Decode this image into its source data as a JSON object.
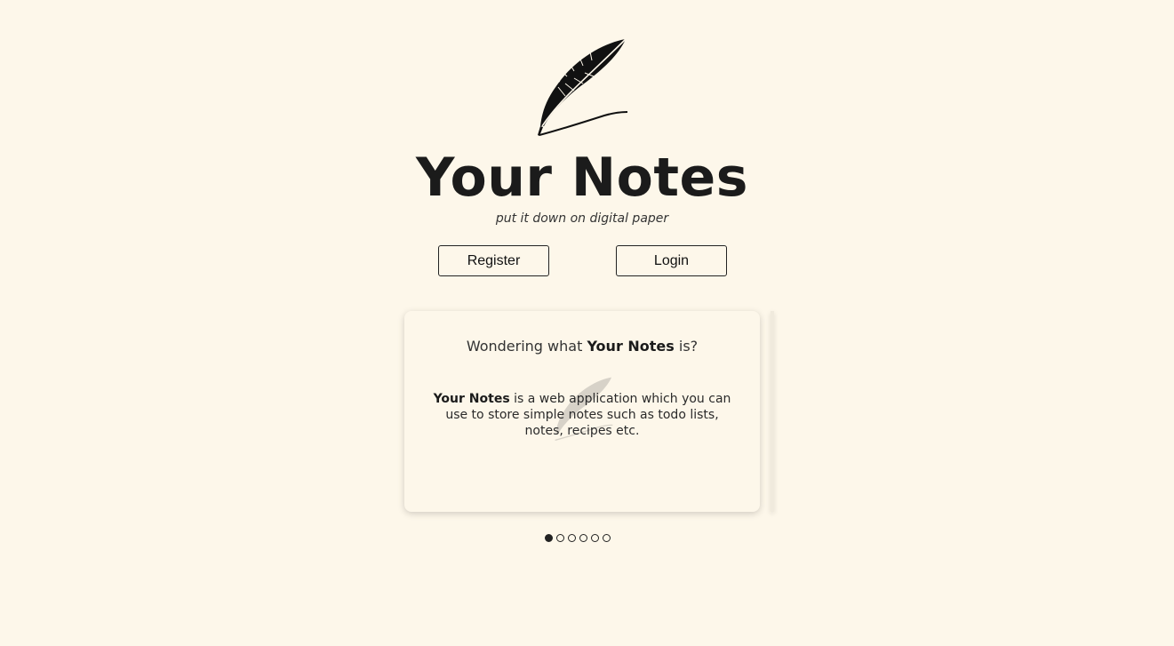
{
  "app": {
    "title": "Your Notes",
    "tagline": "put it down on digital paper",
    "logo_icon": "feather-quill-icon"
  },
  "actions": {
    "register_label": "Register",
    "login_label": "Login"
  },
  "carousel": {
    "active_index": 0,
    "total_slides": 6,
    "slide": {
      "heading_prefix": "Wondering what ",
      "heading_brand": "Your Notes",
      "heading_suffix": " is?",
      "body_brand": "Your Notes",
      "body_text": " is a web application which you can use to store simple notes such as todo lists, notes, recipes etc."
    }
  },
  "colors": {
    "background": "#fdf7ea",
    "text": "#1b1b1b"
  }
}
